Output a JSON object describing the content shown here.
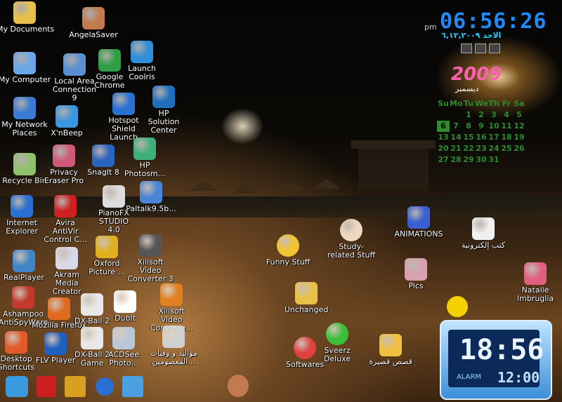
{
  "desktop_icons": [
    {
      "label": "My Documents",
      "icon": "folder-icon",
      "color": "#e7c14a"
    },
    {
      "label": "My Computer",
      "icon": "computer-icon",
      "color": "#6aa6e8"
    },
    {
      "label": "My Network Places",
      "icon": "network-icon",
      "color": "#3a7bd5"
    },
    {
      "label": "Recycle Bin",
      "icon": "recycle-bin-icon",
      "color": "#8fc26b"
    },
    {
      "label": "Internet Explorer",
      "icon": "ie-icon",
      "color": "#2a6fd2"
    },
    {
      "label": "RealPlayer",
      "icon": "realplayer-icon",
      "color": "#3f86c8"
    },
    {
      "label": "Ashampoo AntiSpyWare",
      "icon": "ashampoo-icon",
      "color": "#c0392b"
    },
    {
      "label": "Desktop Shortcuts",
      "icon": "desktop-shortcuts-icon",
      "color": "#e35a2b"
    },
    {
      "label": "AngelaSaver",
      "icon": "avatar-icon",
      "color": "#c47a50"
    },
    {
      "label": "Local Area Connection 9",
      "icon": "network-connection-icon",
      "color": "#5a8fd0"
    },
    {
      "label": "Google Chrome",
      "icon": "chrome-icon",
      "color": "#2f9e44"
    },
    {
      "label": "Launch Coolris",
      "icon": "coolris-icon",
      "color": "#2f8fd8"
    },
    {
      "label": "X'nBeep",
      "icon": "xnbeep-icon",
      "color": "#3a96e0"
    },
    {
      "label": "Hotspot Shield Launch",
      "icon": "hotspot-shield-icon",
      "color": "#2a6fd2"
    },
    {
      "label": "HP Solution Center",
      "icon": "hp-icon",
      "color": "#1f6fbf"
    },
    {
      "label": "Privacy Eraser Pro",
      "icon": "eraser-icon",
      "color": "#d05a7a"
    },
    {
      "label": "SnagIt 8",
      "icon": "snagit-icon",
      "color": "#2a63c0"
    },
    {
      "label": "HP Photosm...",
      "icon": "hp-photosmart-icon",
      "color": "#3db07a"
    },
    {
      "label": "Avira AntiVir Control C...",
      "icon": "avira-icon",
      "color": "#cf1f1f"
    },
    {
      "label": "PianoFX STUDIO 4.0",
      "icon": "piano-icon",
      "color": "#ddd"
    },
    {
      "label": "Paltalk9.5b...",
      "icon": "paltalk-icon",
      "color": "#4a86d8"
    },
    {
      "label": "Akram Media Creator",
      "icon": "media-creator-icon",
      "color": "#d8d8e8"
    },
    {
      "label": "Oxford Picture ...",
      "icon": "dictionary-icon",
      "color": "#e0b020"
    },
    {
      "label": "Xilisoft Video Converter 3",
      "icon": "film-icon",
      "color": "#555"
    },
    {
      "label": "Mozilla Firefox",
      "icon": "firefox-icon",
      "color": "#e06a1f"
    },
    {
      "label": "DX-Ball 2",
      "icon": "ball-icon",
      "color": "#e8e8e8"
    },
    {
      "label": "DubIt",
      "icon": "dubit-icon",
      "color": "#ffffff"
    },
    {
      "label": "Xilisoft Video Converte...",
      "icon": "film-icon",
      "color": "#e08020"
    },
    {
      "label": "FLV Player",
      "icon": "flv-player-icon",
      "color": "#1f5fbf"
    },
    {
      "label": "DX-Ball 2 Game",
      "icon": "ball-icon",
      "color": "#e8e8e8"
    },
    {
      "label": "ACDSee Photo...",
      "icon": "acdsee-icon",
      "color": "#b8c8d8"
    },
    {
      "label": "مواليد و وفيات المعصومين...",
      "icon": "bmp-icon",
      "color": "#d0d0d0"
    },
    {
      "label": "Funny Stuff",
      "icon": "funny-face-icon",
      "color": "#f2c230"
    },
    {
      "label": "Study-related Stuff",
      "icon": "cartoon-face-icon",
      "color": "#f0d8c0"
    },
    {
      "label": "ANIMATIONS",
      "icon": "animations-icon",
      "color": "#3a5fd0"
    },
    {
      "label": "كتب إلكترونية",
      "icon": "books-icon",
      "color": "#f0f0f0"
    },
    {
      "label": "Pics",
      "icon": "photo-icon",
      "color": "#d8a0b0"
    },
    {
      "label": "Natalie Imbruglia",
      "icon": "photo-icon",
      "color": "#e06080"
    },
    {
      "label": "Unchanged",
      "icon": "folder-icon",
      "color": "#e7c14a"
    },
    {
      "label": "Sveerz Deluxe",
      "icon": "smiley-icon",
      "color": "#3ac03a"
    },
    {
      "label": "Softwares",
      "icon": "gears-icon",
      "color": "#e04040"
    },
    {
      "label": "قصص قصيرة",
      "icon": "genie-icon",
      "color": "#f0c040"
    }
  ],
  "widgets": {
    "digital_clock": {
      "ampm": "pm",
      "time": "06:56:26",
      "date_arabic": "الاحد ٦,١٢,٢٠٠٩"
    },
    "calendar": {
      "year": "2009",
      "month_arabic": "ديسمبر",
      "weekdays": [
        "Su",
        "Mo",
        "Tu",
        "We",
        "Th",
        "Fr",
        "Sa"
      ],
      "weeks": [
        [
          "",
          "",
          "1",
          "2",
          "3",
          "4",
          "5"
        ],
        [
          "6",
          "7",
          "8",
          "9",
          "10",
          "11",
          "12"
        ],
        [
          "13",
          "14",
          "15",
          "16",
          "17",
          "18",
          "19"
        ],
        [
          "20",
          "21",
          "22",
          "23",
          "24",
          "25",
          "26"
        ],
        [
          "27",
          "28",
          "29",
          "30",
          "31",
          "",
          ""
        ]
      ],
      "today": "6",
      "accent_color": "#2e8b2e"
    },
    "big_clock": {
      "time": "18:56",
      "alarm_label": "ALARM",
      "alarm_time": "12:00"
    },
    "smiley": {
      "icon": "smiley-icon",
      "color": "#f5d000"
    }
  },
  "taskbar_quick_icons": [
    {
      "icon": "messenger-icon",
      "color": "#3a9ae0"
    },
    {
      "icon": "pdf-icon",
      "color": "#cc1f1f"
    },
    {
      "icon": "archive-icon",
      "color": "#d8a020"
    },
    {
      "icon": "dots-icon",
      "color": "#2a6fd2"
    },
    {
      "icon": "image-icon",
      "color": "#4aa0e0"
    }
  ],
  "bottom_avatar": {
    "icon": "avatar-icon",
    "color": "#c47a50"
  }
}
